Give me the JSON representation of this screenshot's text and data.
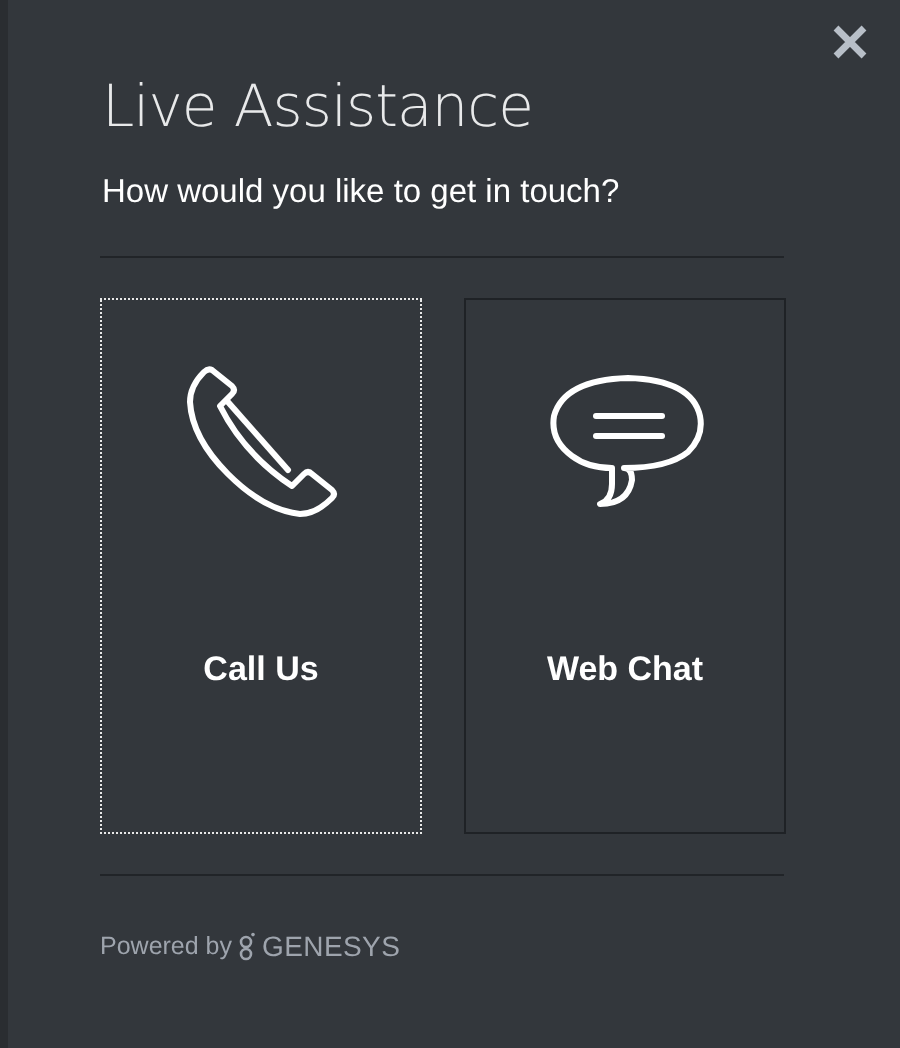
{
  "dialog": {
    "title": "Live Assistance",
    "subtitle": "How would you like to get in touch?"
  },
  "options": [
    {
      "kind": "phone",
      "label": "Call Us",
      "selected": true
    },
    {
      "kind": "chat",
      "label": "Web Chat",
      "selected": false
    }
  ],
  "footer": {
    "prefix": "Powered by",
    "brand": "GENESYS"
  }
}
